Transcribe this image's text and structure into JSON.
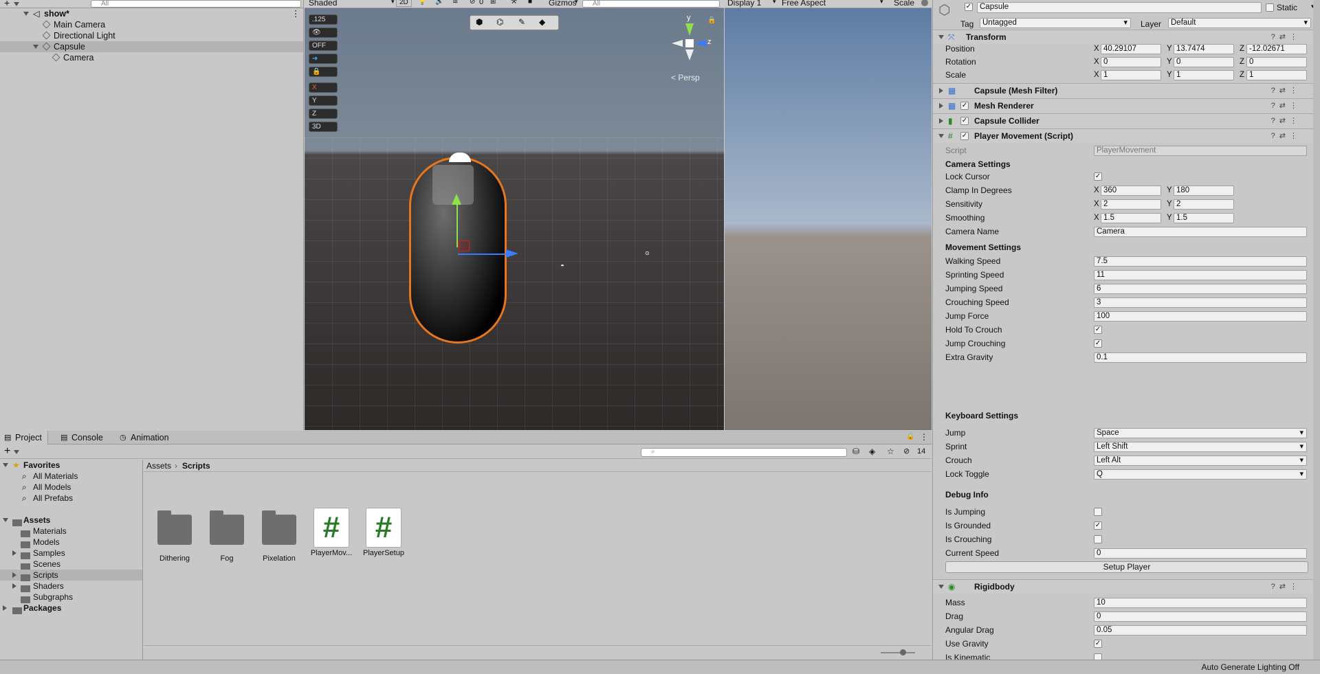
{
  "hierarchy": {
    "search_placeholder": "All",
    "scene_name": "show*",
    "items": [
      {
        "label": "Main Camera"
      },
      {
        "label": "Directional Light"
      },
      {
        "label": "Capsule"
      },
      {
        "label": "Camera"
      }
    ]
  },
  "scene_view": {
    "shading_mode": "Shaded",
    "mode_2d": "2D",
    "hidden_count": "0",
    "gizmos_label": "Gizmos",
    "search_placeholder": "All",
    "persp_label": "< Persp",
    "axis_y": "y",
    "axis_z": "z",
    "overlay_buttons": [
      ".125",
      "OFF",
      "X",
      "Y",
      "Z",
      "3D"
    ]
  },
  "game_view": {
    "display": "Display 1",
    "aspect": "Free Aspect",
    "scale_label": "Scale"
  },
  "inspector": {
    "object_name": "Capsule",
    "static_label": "Static",
    "tag_label": "Tag",
    "tag_value": "Untagged",
    "layer_label": "Layer",
    "layer_value": "Default",
    "transform": {
      "title": "Transform",
      "position": {
        "label": "Position",
        "x": "40.29107",
        "y": "13.7474",
        "z": "-12.02671"
      },
      "rotation": {
        "label": "Rotation",
        "x": "0",
        "y": "0",
        "z": "0"
      },
      "scale": {
        "label": "Scale",
        "x": "1",
        "y": "1",
        "z": "1"
      }
    },
    "components": [
      {
        "title": "Capsule (Mesh Filter)"
      },
      {
        "title": "Mesh Renderer"
      },
      {
        "title": "Capsule Collider"
      },
      {
        "title": "Player Movement (Script)"
      }
    ],
    "script_label": "Script",
    "script_value": "PlayerMovement",
    "camera_settings": {
      "title": "Camera Settings",
      "lock_cursor": "Lock Cursor",
      "clamp": {
        "label": "Clamp In Degrees",
        "x": "360",
        "y": "180"
      },
      "sensitivity": {
        "label": "Sensitivity",
        "x": "2",
        "y": "2"
      },
      "smoothing": {
        "label": "Smoothing",
        "x": "1.5",
        "y": "1.5"
      },
      "camera_name": {
        "label": "Camera Name",
        "value": "Camera"
      }
    },
    "movement_settings": {
      "title": "Movement Settings",
      "walking_speed": {
        "label": "Walking Speed",
        "value": "7.5"
      },
      "sprinting_speed": {
        "label": "Sprinting Speed",
        "value": "11"
      },
      "jumping_speed": {
        "label": "Jumping Speed",
        "value": "6"
      },
      "crouching_speed": {
        "label": "Crouching Speed",
        "value": "3"
      },
      "jump_force": {
        "label": "Jump Force",
        "value": "100"
      },
      "hold_to_crouch": "Hold To Crouch",
      "jump_crouching": "Jump Crouching",
      "extra_gravity": {
        "label": "Extra Gravity",
        "value": "0.1"
      }
    },
    "keyboard_settings": {
      "title": "Keyboard Settings",
      "jump": {
        "label": "Jump",
        "value": "Space"
      },
      "sprint": {
        "label": "Sprint",
        "value": "Left Shift"
      },
      "crouch": {
        "label": "Crouch",
        "value": "Left Alt"
      },
      "lock_toggle": {
        "label": "Lock Toggle",
        "value": "Q"
      }
    },
    "debug_info": {
      "title": "Debug Info",
      "is_jumping": "Is Jumping",
      "is_grounded": "Is Grounded",
      "is_crouching": "Is Crouching",
      "current_speed": {
        "label": "Current Speed",
        "value": "0"
      }
    },
    "setup_button": "Setup Player",
    "rigidbody": {
      "title": "Rigidbody",
      "mass": {
        "label": "Mass",
        "value": "10"
      },
      "drag": {
        "label": "Drag",
        "value": "0"
      },
      "angular_drag": {
        "label": "Angular Drag",
        "value": "0.05"
      },
      "use_gravity": "Use Gravity",
      "is_kinematic": "Is Kinematic"
    },
    "axes": {
      "x": "X",
      "y": "Y",
      "z": "Z"
    }
  },
  "project": {
    "tabs": [
      "Project",
      "Console",
      "Animation"
    ],
    "hidden_count": "14",
    "favorites": {
      "label": "Favorites",
      "items": [
        "All Materials",
        "All Models",
        "All Prefabs"
      ]
    },
    "assets": {
      "label": "Assets",
      "items": [
        "Materials",
        "Models",
        "Samples",
        "Scenes",
        "Scripts",
        "Shaders",
        "Subgraphs"
      ]
    },
    "packages_label": "Packages",
    "breadcrumb": [
      "Assets",
      "Scripts"
    ],
    "files": [
      {
        "name": "Dithering",
        "kind": "folder"
      },
      {
        "name": "Fog",
        "kind": "folder"
      },
      {
        "name": "Pixelation",
        "kind": "folder"
      },
      {
        "name": "PlayerMov...",
        "kind": "script"
      },
      {
        "name": "PlayerSetup",
        "kind": "script"
      }
    ]
  },
  "status": {
    "lighting": "Auto Generate Lighting Off"
  },
  "colors": {
    "selection_outline": "#e8761c",
    "script_hash": "#2a7a2a",
    "panel_bg": "#c8c8c8"
  }
}
